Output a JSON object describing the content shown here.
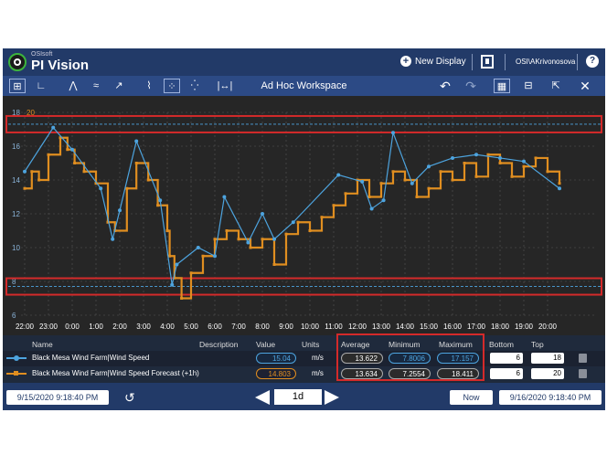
{
  "header": {
    "brand_small": "OSIsoft",
    "brand_main": "PI Vision",
    "new_display_label": "New Display",
    "user": "OSI\\AKrivonosova",
    "help": "?"
  },
  "toolbar": {
    "workspace_title": "Ad Hoc Workspace",
    "range_selector": "|↔| ▾"
  },
  "chart_data": {
    "type": "line",
    "left_axis": {
      "ylim": [
        6,
        18
      ],
      "ticks": [
        "18",
        "16",
        "14",
        "12",
        "10",
        "8",
        "6"
      ],
      "color": "#8ab4d9"
    },
    "right_axis_top_label": "20",
    "x_ticks": [
      "22:00",
      "23:00",
      "0:00",
      "1:00",
      "2:00",
      "3:00",
      "4:00",
      "5:00",
      "6:00",
      "7:00",
      "8:00",
      "9:00",
      "10:00",
      "11:00",
      "12:00",
      "13:00",
      "14:00",
      "15:00",
      "16:00",
      "17:00",
      "18:00",
      "19:00",
      "20:00"
    ],
    "series": [
      {
        "name": "Black Mesa Wind Farm|Wind Speed",
        "color": "#4da4df",
        "x_hours": [
          0,
          1.2,
          2.0,
          3.2,
          3.7,
          4.0,
          4.7,
          5.7,
          6.2,
          6.4,
          7.3,
          8.0,
          8.4,
          9.4,
          10.0,
          10.5,
          11.3,
          13.2,
          14.2,
          14.6,
          15.1,
          15.5,
          16.3,
          17.0,
          18.0,
          19.0,
          20.0,
          21.0,
          22.5
        ],
        "values": [
          14.5,
          17.1,
          15.8,
          13.5,
          10.5,
          12.2,
          16.3,
          12.8,
          7.8,
          9.0,
          10.0,
          9.5,
          13.0,
          10.3,
          12.0,
          10.5,
          11.5,
          14.3,
          13.9,
          12.3,
          12.8,
          16.8,
          13.8,
          14.8,
          15.3,
          15.5,
          15.3,
          15.1,
          13.5
        ]
      },
      {
        "name": "Black Mesa Wind Farm|Wind Speed Forecast (+1h)",
        "color": "#e08e20",
        "x_hours": [
          0,
          0.3,
          0.6,
          1.0,
          1.5,
          1.8,
          2.1,
          2.5,
          3.0,
          3.5,
          3.8,
          4.3,
          4.7,
          5.2,
          5.6,
          6.0,
          6.1,
          6.3,
          6.6,
          7.0,
          7.5,
          8.0,
          8.5,
          9.0,
          9.5,
          10.0,
          10.5,
          11.0,
          11.5,
          12.0,
          12.5,
          13.0,
          13.5,
          14.0,
          14.5,
          15.0,
          15.5,
          16.0,
          16.5,
          17.0,
          17.5,
          18.0,
          18.5,
          19.0,
          19.5,
          20.0,
          20.5,
          21.0,
          21.5,
          22.0,
          22.5
        ],
        "values": [
          13.5,
          14.5,
          14.0,
          15.5,
          16.5,
          15.8,
          15.0,
          14.5,
          13.8,
          11.5,
          11.0,
          13.5,
          15.0,
          14.0,
          12.5,
          11.0,
          9.5,
          8.2,
          7.0,
          8.5,
          9.5,
          10.5,
          11.0,
          10.5,
          10.0,
          10.5,
          9.0,
          10.8,
          11.5,
          11.0,
          11.8,
          12.5,
          13.2,
          14.0,
          13.0,
          13.8,
          14.5,
          14.0,
          13.0,
          13.5,
          14.5,
          14.0,
          15.0,
          14.2,
          15.5,
          15.0,
          14.2,
          14.8,
          15.3,
          14.5,
          13.8
        ]
      }
    ],
    "bands": [
      {
        "y_center": 17.3,
        "label": "upper limit band"
      },
      {
        "y_center": 7.7,
        "label": "lower limit band"
      }
    ],
    "grid": true
  },
  "legend": {
    "headers": [
      "Name",
      "Description",
      "Value",
      "Units",
      "Average",
      "Minimum",
      "Maximum",
      "Bottom",
      "Top"
    ],
    "rows": [
      {
        "name": "Black Mesa Wind Farm|Wind Speed",
        "value": "15.04",
        "units": "m/s",
        "average": "13.622",
        "minimum": "7.8006",
        "maximum": "17.157",
        "bottom": "6",
        "top": "18",
        "color": "#4da4df"
      },
      {
        "name": "Black Mesa Wind Farm|Wind Speed Forecast (+1h)",
        "value": "14.803",
        "units": "m/s",
        "average": "13.634",
        "minimum": "7.2554",
        "maximum": "18.411",
        "bottom": "6",
        "top": "20",
        "color": "#e08e20"
      }
    ]
  },
  "footer": {
    "start_time": "9/15/2020 9:18:40 PM",
    "duration": "1d",
    "now_label": "Now",
    "end_time": "9/16/2020 9:18:40 PM"
  },
  "colors": {
    "header_bg": "#223a68",
    "toolbar_bg": "#2c4a85",
    "chart_bg": "#262626",
    "highlight_red": "#d42a2a"
  }
}
